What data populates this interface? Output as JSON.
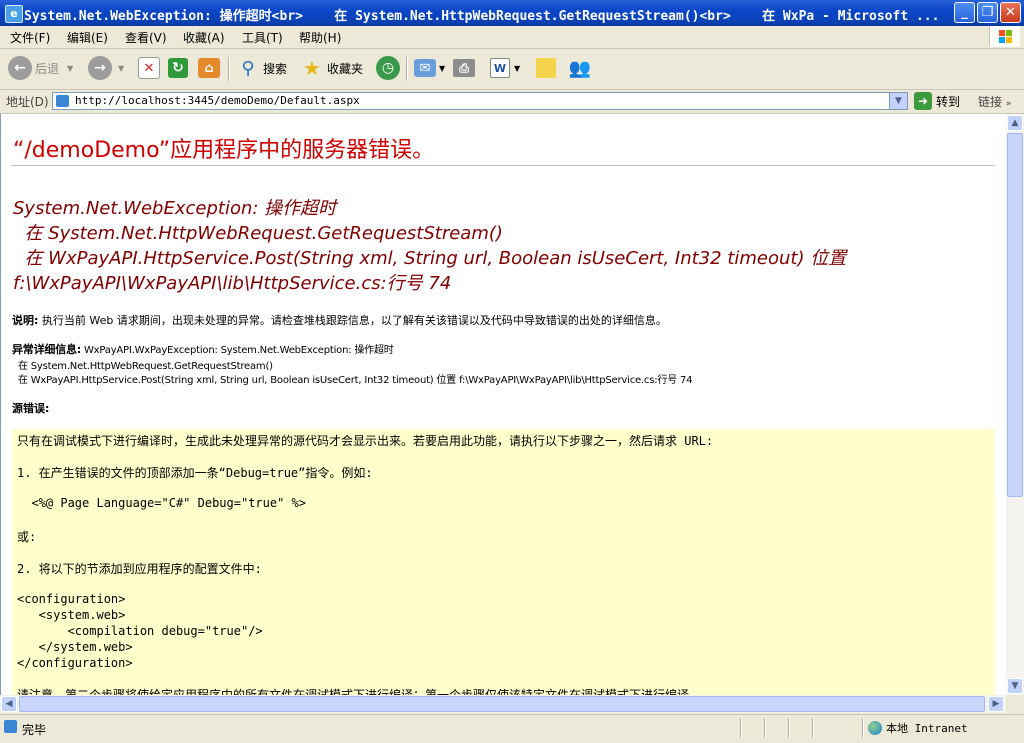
{
  "window": {
    "title": "System.Net.WebException: 操作超时<br>    在 System.Net.HttpWebRequest.GetRequestStream()<br>    在 WxPa - Microsoft ..."
  },
  "menu": [
    "文件(F)",
    "编辑(E)",
    "查看(V)",
    "收藏(A)",
    "工具(T)",
    "帮助(H)"
  ],
  "toolbar": {
    "back_label": "后退",
    "search_label": "搜索",
    "favorites_label": "收藏夹"
  },
  "address": {
    "label": "地址(D)",
    "url": "http://localhost:3445/demoDemo/Default.aspx",
    "go_label": "转到",
    "links_label": "链接"
  },
  "page": {
    "heading": "“/demoDemo”应用程序中的服务器错误。",
    "exception_lines": [
      "System.Net.WebException: 操作超时",
      "  在 System.Net.HttpWebRequest.GetRequestStream()",
      "  在 WxPayAPI.HttpService.Post(String xml, String url, Boolean isUseCert, Int32 timeout) 位置",
      "f:\\WxPayAPI\\WxPayAPI\\lib\\HttpService.cs:行号 74"
    ],
    "description_label": "说明:",
    "description_text": " 执行当前 Web 请求期间，出现未处理的异常。请检查堆栈跟踪信息，以了解有关该错误以及代码中导致错误的出处的详细信息。",
    "exception_details_label": "异常详细信息:",
    "exception_details_text": " WxPayAPI.WxPayException: System.Net.WebException: 操作超时",
    "exception_details_line2": "  在 System.Net.HttpWebRequest.GetRequestStream()",
    "exception_details_line3": "  在 WxPayAPI.HttpService.Post(String xml, String url, Boolean isUseCert, Int32 timeout) 位置 f:\\WxPayAPI\\WxPayAPI\\lib\\HttpService.cs:行号 74",
    "source_error_label": "源错误:",
    "code_lines": [
      "只有在调试模式下进行编译时，生成此未处理异常的源代码才会显示出来。若要启用此功能，请执行以下步骤之一，然后请求 URL:",
      "1. 在产生错误的文件的顶部添加一条“Debug=true”指令。例如:",
      "  <%@ Page Language=\"C#\" Debug=\"true\" %>",
      "或:",
      "2. 将以下的节添加到应用程序的配置文件中:",
      "<configuration>",
      "   <system.web>",
      "       <compilation debug=\"true\"/>",
      "   </system.web>",
      "</configuration>",
      "请注意，第二个步骤将使给定应用程序中的所有文件在调试模式下进行编译；第一个步骤仅使该特定文件在调试模式下进行编译。"
    ]
  },
  "status": {
    "text": "完毕",
    "zone": "本地 Intranet"
  }
}
